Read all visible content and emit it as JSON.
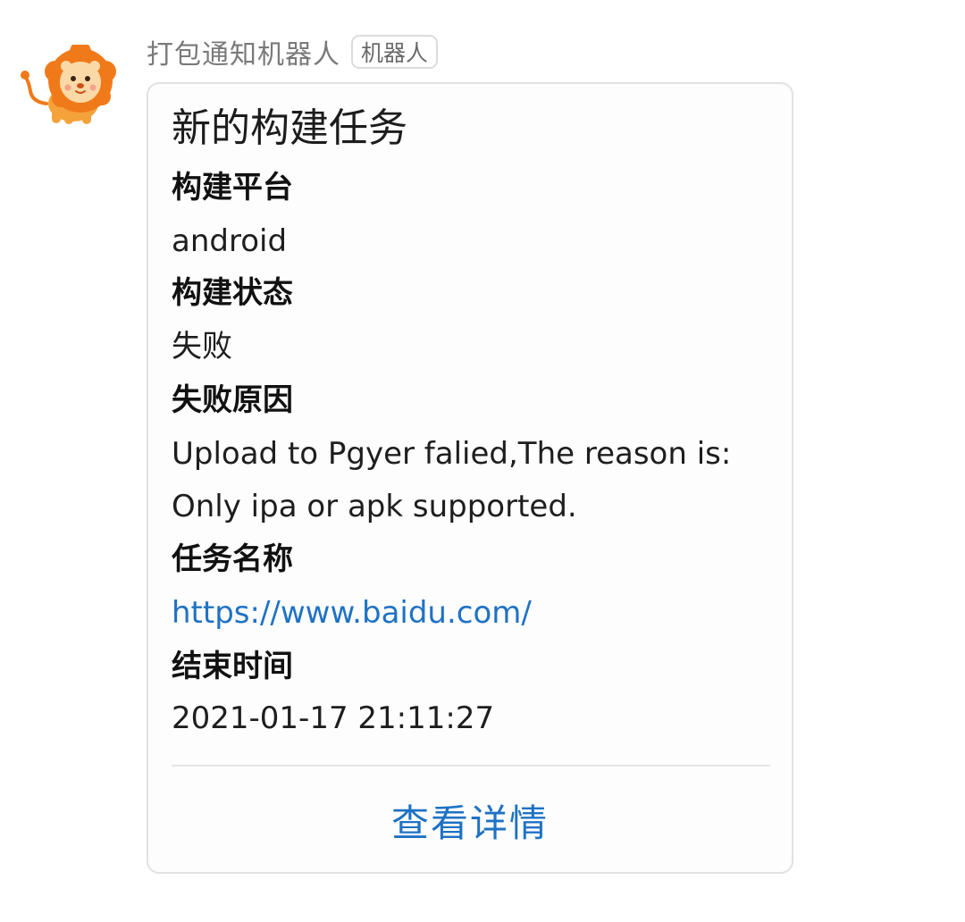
{
  "message": {
    "sender": {
      "name": "打包通知机器人",
      "tag": "机器人",
      "avatar_icon": "lion-avatar-icon"
    },
    "card": {
      "title": "新的构建任务",
      "fields": {
        "platform": {
          "label": "构建平台",
          "value": "android"
        },
        "status": {
          "label": "构建状态",
          "value": "失败"
        },
        "reason": {
          "label": "失败原因",
          "line1": "Upload to Pgyer falied,The reason is:",
          "line2": "Only ipa or apk supported."
        },
        "task": {
          "label": "任务名称",
          "value": "https://www.baidu.com/"
        },
        "end_time": {
          "label": "结束时间",
          "value": "2021-01-17 21:11:27"
        }
      },
      "action_label": "查看详情"
    }
  },
  "colors": {
    "link": "#1f72c4",
    "avatar_mane": "#f07a1a",
    "avatar_face": "#fbd9a6",
    "card_border": "#e2e2e2"
  }
}
